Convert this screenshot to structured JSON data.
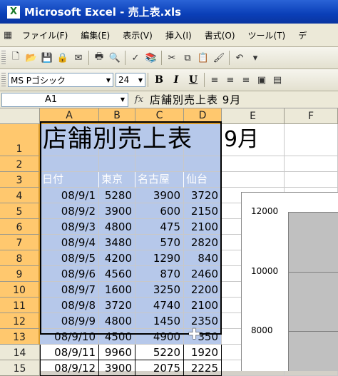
{
  "window": {
    "title": "Microsoft Excel - 売上表.xls"
  },
  "menu": [
    "ファイル(F)",
    "編集(E)",
    "表示(V)",
    "挿入(I)",
    "書式(O)",
    "ツール(T)",
    "デ"
  ],
  "toolbar": {
    "font_name": "MS Pゴシック",
    "font_size": "24",
    "bold": "B",
    "italic": "I",
    "underline": "U"
  },
  "formula": {
    "cell_ref": "A1",
    "fx": "fx",
    "value": "店舗別売上表 9月"
  },
  "columns": [
    "A",
    "B",
    "C",
    "D",
    "E",
    "F"
  ],
  "rows": [
    "1",
    "2",
    "3",
    "4",
    "5",
    "6",
    "7",
    "8",
    "9",
    "10",
    "11",
    "12",
    "13",
    "14",
    "15"
  ],
  "sheet": {
    "title": "店舗別売上表",
    "month": "9月",
    "headers": [
      "日付",
      "東京",
      "名古屋",
      "仙台"
    ],
    "data": [
      [
        "08/9/1",
        "5280",
        "3900",
        "3720"
      ],
      [
        "08/9/2",
        "3900",
        "600",
        "2150"
      ],
      [
        "08/9/3",
        "4800",
        "475",
        "2100"
      ],
      [
        "08/9/4",
        "3480",
        "570",
        "2820"
      ],
      [
        "08/9/5",
        "4200",
        "1290",
        "840"
      ],
      [
        "08/9/6",
        "4560",
        "870",
        "2460"
      ],
      [
        "08/9/7",
        "1600",
        "3250",
        "2200"
      ],
      [
        "08/9/8",
        "3720",
        "4740",
        "2100"
      ],
      [
        "08/9/9",
        "4800",
        "1450",
        "2350"
      ],
      [
        "08/9/10",
        "4500",
        "4900",
        "350"
      ],
      [
        "08/9/11",
        "9960",
        "5220",
        "1920"
      ],
      [
        "08/9/12",
        "3900",
        "2075",
        "2225"
      ]
    ]
  },
  "chart": {
    "y_ticks": [
      "12000",
      "10000",
      "8000"
    ]
  }
}
